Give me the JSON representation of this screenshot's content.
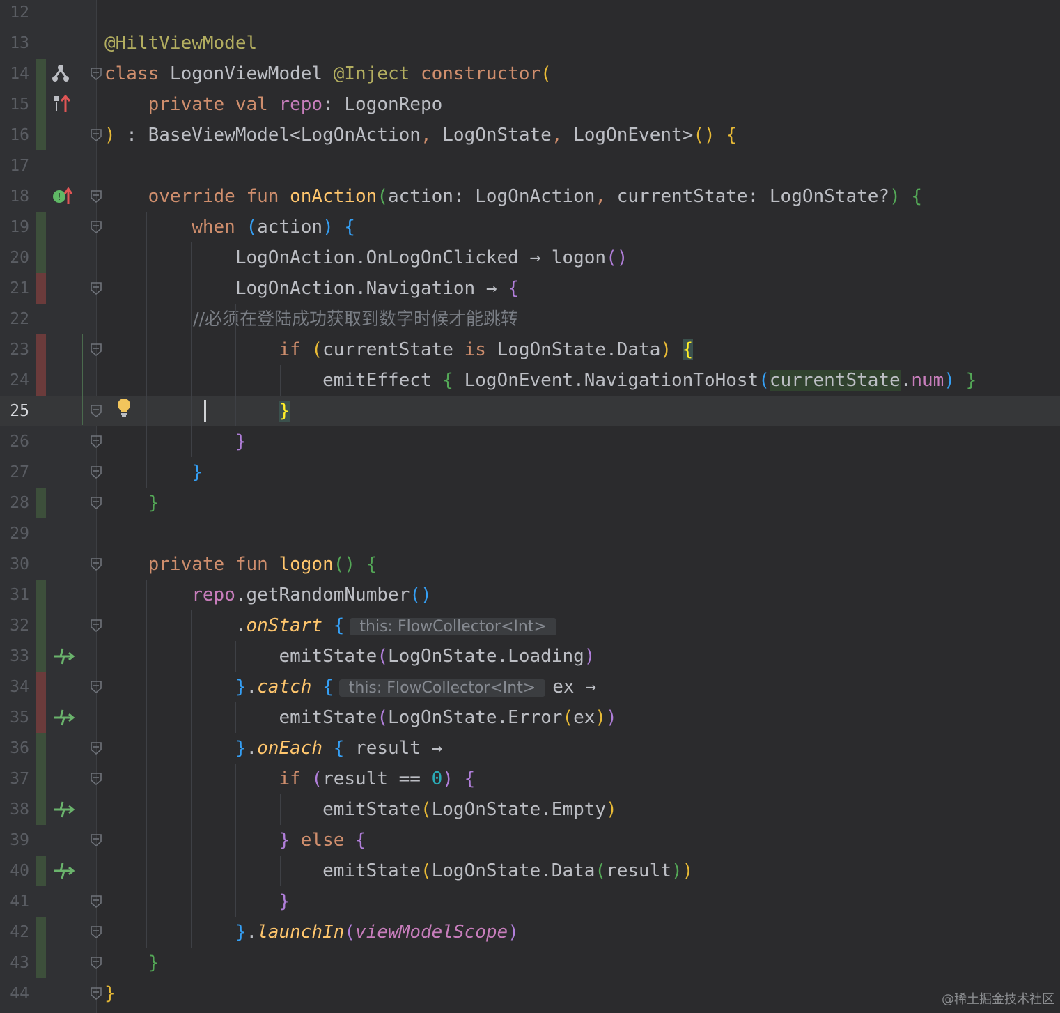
{
  "editor": {
    "language": "kotlin",
    "current_line": 25,
    "lines": [
      {
        "n": "12",
        "tokens": []
      },
      {
        "n": "13",
        "tokens": [
          [
            "@HiltViewModel",
            "t-ann"
          ]
        ]
      },
      {
        "n": "14",
        "tokens": [
          [
            "class ",
            "t-kw"
          ],
          [
            "LogonViewModel ",
            ""
          ],
          [
            "@Inject ",
            "t-ann"
          ],
          [
            "constructor",
            "t-kw"
          ],
          [
            "(",
            "b1"
          ]
        ]
      },
      {
        "n": "15",
        "tokens": [
          [
            "    private val ",
            "t-kw"
          ],
          [
            "repo",
            "t-prop"
          ],
          [
            ": LogonRepo",
            ""
          ]
        ]
      },
      {
        "n": "16",
        "tokens": [
          [
            ")",
            "b1"
          ],
          [
            " : BaseViewModel<LogOnAction",
            ""
          ],
          [
            ", ",
            "t-kw"
          ],
          [
            "LogOnState",
            ""
          ],
          [
            ", ",
            "t-kw"
          ],
          [
            "LogOnEvent>",
            ""
          ],
          [
            "()",
            "b1"
          ],
          [
            " ",
            ""
          ],
          [
            "{",
            "b1"
          ]
        ]
      },
      {
        "n": "17",
        "tokens": []
      },
      {
        "n": "18",
        "tokens": [
          [
            "    override fun ",
            "t-kw"
          ],
          [
            "onAction",
            "t-fnd"
          ],
          [
            "(",
            "b2"
          ],
          [
            "action: LogOnAction",
            ""
          ],
          [
            ", ",
            "t-kw"
          ],
          [
            "currentState: LogOnState?",
            ""
          ],
          [
            ")",
            "b2"
          ],
          [
            " ",
            ""
          ],
          [
            "{",
            "b2"
          ]
        ]
      },
      {
        "n": "19",
        "tokens": [
          [
            "        when ",
            "t-kw"
          ],
          [
            "(",
            "b3"
          ],
          [
            "action",
            ""
          ],
          [
            ")",
            "b3"
          ],
          [
            " ",
            ""
          ],
          [
            "{",
            "b3"
          ]
        ]
      },
      {
        "n": "20",
        "tokens": [
          [
            "            LogOnAction.OnLogOnClicked → logon",
            ""
          ],
          [
            "()",
            "b4"
          ]
        ]
      },
      {
        "n": "21",
        "tokens": [
          [
            "            LogOnAction.Navigation → ",
            ""
          ],
          [
            "{",
            "b4"
          ]
        ]
      },
      {
        "n": "22",
        "tokens": [
          [
            "                //必须在登陆成功获取到数字时候才能跳转",
            "t-cm"
          ]
        ]
      },
      {
        "n": "23",
        "tokens": [
          [
            "                if ",
            "t-kw"
          ],
          [
            "(",
            "b1"
          ],
          [
            "currentState ",
            ""
          ],
          [
            "is ",
            "t-kw"
          ],
          [
            "LogOnState.Data",
            ""
          ],
          [
            ")",
            "b1"
          ],
          [
            " ",
            ""
          ],
          [
            "{",
            "hl-brace"
          ]
        ]
      },
      {
        "n": "24",
        "tokens": [
          [
            "                    emitEffect ",
            ""
          ],
          [
            "{",
            "b2"
          ],
          [
            " LogOnEvent.NavigationToHost",
            ""
          ],
          [
            "(",
            "b3"
          ],
          [
            "currentState",
            "hl-var"
          ],
          [
            ".",
            ""
          ],
          [
            "num",
            "t-prop"
          ],
          [
            ")",
            "b3"
          ],
          [
            " ",
            ""
          ],
          [
            "}",
            "b2"
          ]
        ]
      },
      {
        "n": "25",
        "tokens": [
          [
            "                ",
            ""
          ],
          [
            "}",
            "hl-brace"
          ]
        ]
      },
      {
        "n": "26",
        "tokens": [
          [
            "            ",
            ""
          ],
          [
            "}",
            "b4"
          ]
        ]
      },
      {
        "n": "27",
        "tokens": [
          [
            "        ",
            ""
          ],
          [
            "}",
            "b3"
          ]
        ]
      },
      {
        "n": "28",
        "tokens": [
          [
            "    ",
            ""
          ],
          [
            "}",
            "b2"
          ]
        ]
      },
      {
        "n": "29",
        "tokens": []
      },
      {
        "n": "30",
        "tokens": [
          [
            "    private fun ",
            "t-kw"
          ],
          [
            "logon",
            "t-fnd"
          ],
          [
            "()",
            "b2"
          ],
          [
            " ",
            ""
          ],
          [
            "{",
            "b2"
          ]
        ]
      },
      {
        "n": "31",
        "tokens": [
          [
            "        ",
            ""
          ],
          [
            "repo",
            "t-prop"
          ],
          [
            ".getRandomNumber",
            ""
          ],
          [
            "()",
            "b3"
          ]
        ]
      },
      {
        "n": "32",
        "tokens": [
          [
            "            .",
            ""
          ],
          [
            "onStart",
            "t-it"
          ],
          [
            " ",
            ""
          ],
          [
            "{",
            "b3"
          ],
          [
            "this: FlowCollector<Int>",
            "hint"
          ]
        ]
      },
      {
        "n": "33",
        "tokens": [
          [
            "                emitState",
            ""
          ],
          [
            "(",
            "b4"
          ],
          [
            "LogOnState.Loading",
            ""
          ],
          [
            ")",
            "b4"
          ]
        ]
      },
      {
        "n": "34",
        "tokens": [
          [
            "            ",
            ""
          ],
          [
            "}",
            "b3"
          ],
          [
            ".",
            ""
          ],
          [
            "catch",
            "t-it"
          ],
          [
            " ",
            ""
          ],
          [
            "{",
            "b3"
          ],
          [
            "this: FlowCollector<Int>",
            "hint"
          ],
          [
            "ex →",
            ""
          ]
        ]
      },
      {
        "n": "35",
        "tokens": [
          [
            "                emitState",
            ""
          ],
          [
            "(",
            "b4"
          ],
          [
            "LogOnState.Error",
            ""
          ],
          [
            "(",
            "b1"
          ],
          [
            "ex",
            ""
          ],
          [
            ")",
            "b1"
          ],
          [
            ")",
            "b4"
          ]
        ]
      },
      {
        "n": "36",
        "tokens": [
          [
            "            ",
            ""
          ],
          [
            "}",
            "b3"
          ],
          [
            ".",
            ""
          ],
          [
            "onEach",
            "t-it"
          ],
          [
            " ",
            ""
          ],
          [
            "{",
            "b3"
          ],
          [
            " result →",
            ""
          ]
        ]
      },
      {
        "n": "37",
        "tokens": [
          [
            "                if ",
            "t-kw"
          ],
          [
            "(",
            "b4"
          ],
          [
            "result == ",
            ""
          ],
          [
            "0",
            "t-num"
          ],
          [
            ")",
            "b4"
          ],
          [
            " ",
            ""
          ],
          [
            "{",
            "b4"
          ]
        ]
      },
      {
        "n": "38",
        "tokens": [
          [
            "                    emitState",
            ""
          ],
          [
            "(",
            "b1"
          ],
          [
            "LogOnState.Empty",
            ""
          ],
          [
            ")",
            "b1"
          ]
        ]
      },
      {
        "n": "39",
        "tokens": [
          [
            "                ",
            ""
          ],
          [
            "}",
            "b4"
          ],
          [
            " else ",
            "t-kw"
          ],
          [
            "{",
            "b4"
          ]
        ]
      },
      {
        "n": "40",
        "tokens": [
          [
            "                    emitState",
            ""
          ],
          [
            "(",
            "b1"
          ],
          [
            "LogOnState.Data",
            ""
          ],
          [
            "(",
            "b2"
          ],
          [
            "result",
            ""
          ],
          [
            ")",
            "b2"
          ],
          [
            ")",
            "b1"
          ]
        ]
      },
      {
        "n": "41",
        "tokens": [
          [
            "                ",
            ""
          ],
          [
            "}",
            "b4"
          ]
        ]
      },
      {
        "n": "42",
        "tokens": [
          [
            "            ",
            ""
          ],
          [
            "}",
            "b3"
          ],
          [
            ".",
            ""
          ],
          [
            "launchIn",
            "t-it"
          ],
          [
            "(",
            "b4"
          ],
          [
            "viewModelScope",
            "t-i"
          ],
          [
            ")",
            "b4"
          ]
        ]
      },
      {
        "n": "43",
        "tokens": [
          [
            "    ",
            ""
          ],
          [
            "}",
            "b2"
          ]
        ]
      },
      {
        "n": "44",
        "tokens": [
          [
            "}",
            "b1"
          ]
        ]
      }
    ]
  },
  "gutter": {
    "changes": {
      "14": "g",
      "15": "g",
      "16": "g",
      "19": "g",
      "20": "g",
      "21": "r",
      "23": "r",
      "24": "r",
      "28": "g",
      "31": "g",
      "32": "g",
      "33": "g",
      "34": "r",
      "35": "r",
      "36": "g",
      "37": "g",
      "38": "g",
      "40": "g",
      "42": "g",
      "43": "g"
    },
    "icons": {
      "14": "hierarchy-icon",
      "15": "implemented-override-icon",
      "18": "override-method-icon",
      "33": "suspend-call-icon",
      "35": "suspend-call-icon",
      "38": "suspend-call-icon",
      "40": "suspend-call-icon"
    },
    "folds": [
      "14",
      "16",
      "18",
      "19",
      "21",
      "23",
      "25",
      "26",
      "27",
      "28",
      "30",
      "32",
      "34",
      "36",
      "37",
      "39",
      "41",
      "42",
      "43",
      "44"
    ],
    "icon_colors": {
      "hierarchy": "#bcbec4",
      "override": "#5fb865",
      "arrow_up": "#e05555",
      "suspend": "#6ab36c",
      "bulb": "#f2c55c"
    }
  },
  "watermark": "@稀土掘金技术社区"
}
